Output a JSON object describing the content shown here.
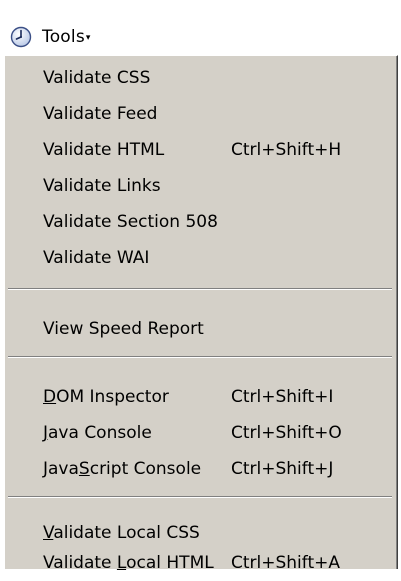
{
  "toolbar": {
    "label": "Tools",
    "caret": "▾"
  },
  "menu": {
    "group1": [
      {
        "label": "Validate CSS"
      },
      {
        "label": "Validate Feed"
      },
      {
        "label": "Validate HTML",
        "shortcut": "Ctrl+Shift+H"
      },
      {
        "label": "Validate Links"
      },
      {
        "label": "Validate Section 508"
      },
      {
        "label": "Validate WAI"
      }
    ],
    "group2": [
      {
        "label": "View Speed Report"
      }
    ],
    "group3": [
      {
        "pre": "",
        "accel": "D",
        "post": "OM Inspector",
        "shortcut": "Ctrl+Shift+I"
      },
      {
        "pre": "",
        "accel": "J",
        "post": "ava Console",
        "shortcut": "Ctrl+Shift+O"
      },
      {
        "pre": "Java",
        "accel": "S",
        "post": "cript Console",
        "shortcut": "Ctrl+Shift+J"
      }
    ],
    "group4": [
      {
        "pre": "",
        "accel": "V",
        "post": "alidate Local CSS"
      },
      {
        "pre": "Validate ",
        "accel": "L",
        "post": "ocal HTML",
        "shortcut": "Ctrl+Shift+A"
      }
    ]
  }
}
